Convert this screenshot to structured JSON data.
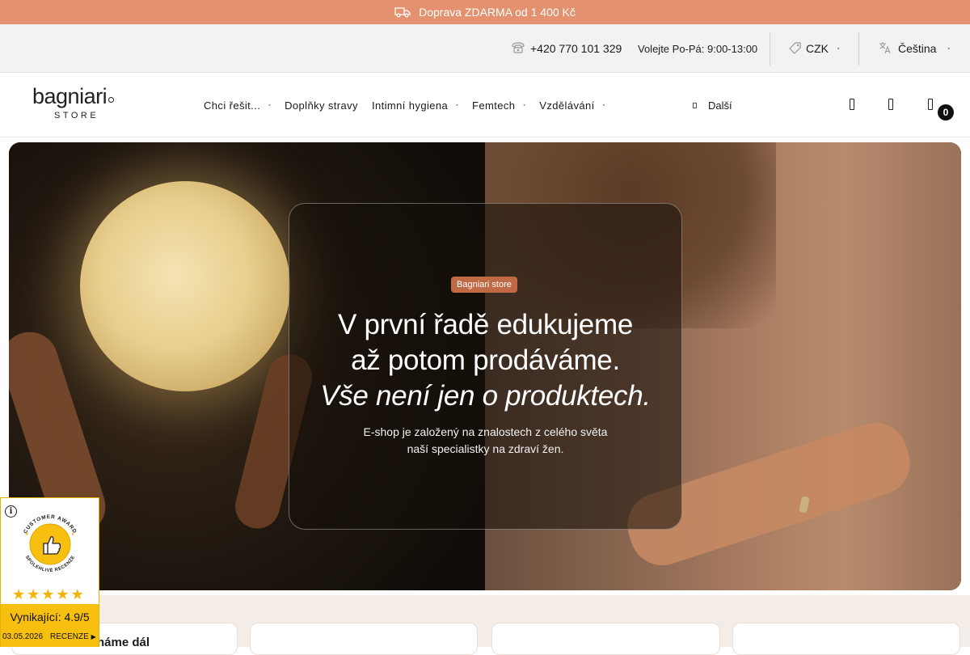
{
  "promo": {
    "text": "Doprava ZDARMA od 1 400 Kč",
    "icon": "truck-icon"
  },
  "utility": {
    "phone": "+420 770 101 329",
    "hours": "Volejte Po-Pá: 9:00-13:00",
    "currency": "CZK",
    "language": "Čeština"
  },
  "logo": {
    "name": "bagniari",
    "sub": "STORE"
  },
  "nav": {
    "items": [
      {
        "label": "Chci řešit...",
        "has_dropdown": true
      },
      {
        "label": "Doplňky stravy",
        "has_dropdown": false
      },
      {
        "label": "Intimní hygiena",
        "has_dropdown": true
      },
      {
        "label": "Femtech",
        "has_dropdown": true
      },
      {
        "label": "Vzdělávání",
        "has_dropdown": true
      }
    ],
    "more": "Další"
  },
  "cart": {
    "count": "0"
  },
  "hero": {
    "badge": "Bagniari store",
    "line1": "V první řadě edukujeme",
    "line2": "až potom prodáváme.",
    "line3": "Vše není jen o produktech.",
    "p1": "E-shop je založený na znalostech z celého světa",
    "p2": "naší specialistky na zdraví žen."
  },
  "lower": {
    "partial_heading": "háme dál"
  },
  "award": {
    "seal_top": "CUSTOMER AWARD",
    "seal_bottom": "SPOLEHLIVÉ RECENZE",
    "stars": 5,
    "score": "Vynikající: 4.9/5",
    "date": "03.05.2026",
    "reviews": "RECENZE"
  },
  "colors": {
    "promo_bg": "#e3916e",
    "badge_bg": "#c06a45",
    "award_yellow": "#f7bf0f"
  }
}
